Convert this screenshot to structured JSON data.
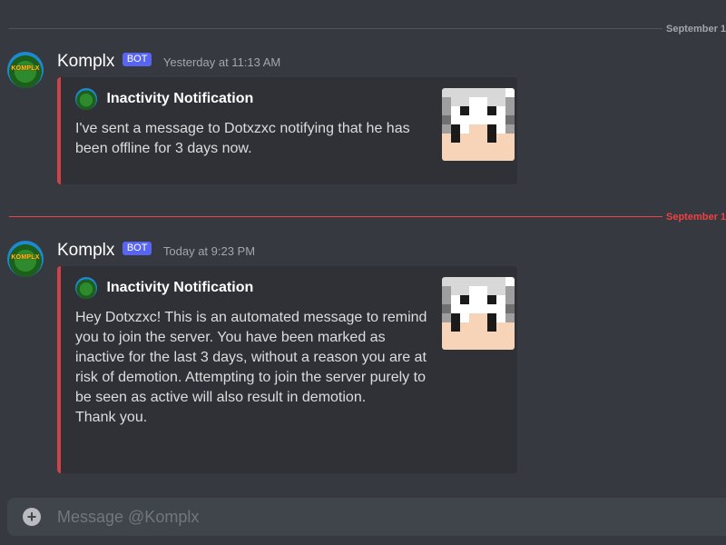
{
  "dividers": [
    {
      "label": "September 1"
    },
    {
      "label": "September 1"
    }
  ],
  "messages": [
    {
      "author": "Komplx",
      "bot_tag": "BOT",
      "timestamp": "Yesterday at 11:13 AM",
      "avatar_text": "KOMPLX",
      "embed": {
        "author": "Inactivity Notification",
        "color": "#d0414a",
        "description": "I've sent a message to Dotxzxc notifying that he has been offline for 3 days now."
      }
    },
    {
      "author": "Komplx",
      "bot_tag": "BOT",
      "timestamp": "Today at 9:23 PM",
      "avatar_text": "KOMPLX",
      "embed": {
        "author": "Inactivity Notification",
        "color": "#d0414a",
        "description": "Hey Dotxzxc! This is an automated message to remind you to join the server. You have been marked as inactive for the last 3 days, without a reason you are at risk of demotion. Attempting to join the server purely to be seen as active will also result in demotion.\nThank you."
      }
    }
  ],
  "input": {
    "placeholder": "Message @Komplx",
    "attach_icon": "plus-circle-icon"
  },
  "colors": {
    "background": "#36393f",
    "embed_bg": "#2f3136",
    "bot_tag": "#5865f2",
    "new_divider": "#ed4245"
  }
}
